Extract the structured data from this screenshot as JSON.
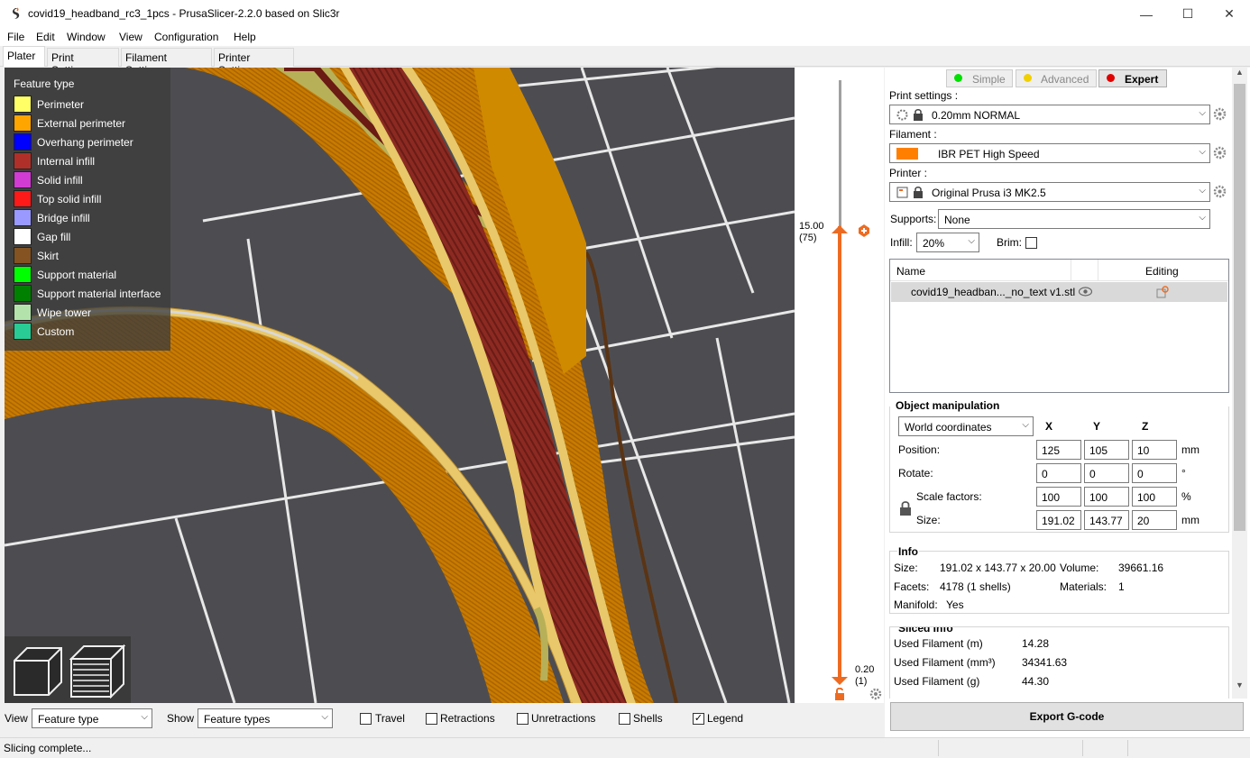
{
  "window": {
    "title": "covid19_headband_rc3_1pcs - PrusaSlicer-2.2.0 based on Slic3r",
    "minimize": "—",
    "maximize": "☐",
    "close": "✕"
  },
  "menu": [
    "File",
    "Edit",
    "Window",
    "View",
    "Configuration",
    "Help"
  ],
  "tabs": [
    "Plater",
    "Print Settings",
    "Filament Settings",
    "Printer Settings"
  ],
  "legend": {
    "title": "Feature type",
    "items": [
      {
        "label": "Perimeter",
        "color": "#ffff66"
      },
      {
        "label": "External perimeter",
        "color": "#ffa500"
      },
      {
        "label": "Overhang perimeter",
        "color": "#0000ff"
      },
      {
        "label": "Internal infill",
        "color": "#b03029"
      },
      {
        "label": "Solid infill",
        "color": "#d23cd2"
      },
      {
        "label": "Top solid infill",
        "color": "#ff1a1a"
      },
      {
        "label": "Bridge infill",
        "color": "#9999ff"
      },
      {
        "label": "Gap fill",
        "color": "#ffffff"
      },
      {
        "label": "Skirt",
        "color": "#845321"
      },
      {
        "label": "Support material",
        "color": "#00ff00"
      },
      {
        "label": "Support material interface",
        "color": "#008000"
      },
      {
        "label": "Wipe tower",
        "color": "#b3e3ab"
      },
      {
        "label": "Custom",
        "color": "#28cc94"
      }
    ]
  },
  "layers": {
    "top_value": "15.00",
    "top_layer": "(75)",
    "bottom_value": "0.20",
    "bottom_layer": "(1)"
  },
  "modes": {
    "simple": "Simple",
    "advanced": "Advanced",
    "expert": "Expert"
  },
  "print_settings": {
    "label": "Print settings :",
    "value": "0.20mm NORMAL"
  },
  "filament": {
    "label": "Filament :",
    "value": "IBR PET High Speed",
    "color": "#ff8000"
  },
  "printer": {
    "label": "Printer :",
    "value": "Original Prusa i3 MK2.5"
  },
  "supports": {
    "label": "Supports:",
    "value": "None"
  },
  "infill": {
    "label": "Infill:",
    "value": "20%"
  },
  "brim": {
    "label": "Brim:"
  },
  "object_list": {
    "col_name": "Name",
    "col_editing": "Editing",
    "objects": [
      {
        "name": "covid19_headban..._no_text v1.stl"
      }
    ]
  },
  "object_manipulation": {
    "title": "Object manipulation",
    "coord_system": "World coordinates",
    "x": "X",
    "y": "Y",
    "z": "Z",
    "position_label": "Position:",
    "position": [
      "125",
      "105",
      "10"
    ],
    "position_unit": "mm",
    "rotate_label": "Rotate:",
    "rotate": [
      "0",
      "0",
      "0"
    ],
    "rotate_unit": "°",
    "scale_label": "Scale factors:",
    "scale": [
      "100",
      "100",
      "100"
    ],
    "scale_unit": "%",
    "size_label": "Size:",
    "size": [
      "191.02",
      "143.77",
      "20"
    ],
    "size_unit": "mm"
  },
  "info": {
    "title": "Info",
    "size_label": "Size:",
    "size": "191.02 x 143.77 x 20.00",
    "volume_label": "Volume:",
    "volume": "39661.16",
    "facets_label": "Facets:",
    "facets": "4178 (1 shells)",
    "materials_label": "Materials:",
    "materials": "1",
    "manifold_label": "Manifold:",
    "manifold": "Yes"
  },
  "sliced_info": {
    "title": "Sliced Info",
    "rows": [
      {
        "label": "Used Filament (m)",
        "value": "14.28"
      },
      {
        "label": "Used Filament (mm³)",
        "value": "34341.63"
      },
      {
        "label": "Used Filament (g)",
        "value": "44.30"
      }
    ]
  },
  "export": {
    "label": "Export G-code"
  },
  "bottom": {
    "view_label": "View",
    "view_value": "Feature type",
    "show_label": "Show",
    "show_value": "Feature types",
    "travel": "Travel",
    "retractions": "Retractions",
    "unretractions": "Unretractions",
    "shells": "Shells",
    "legend": "Legend",
    "legend_checked": true
  },
  "status": "Slicing complete..."
}
